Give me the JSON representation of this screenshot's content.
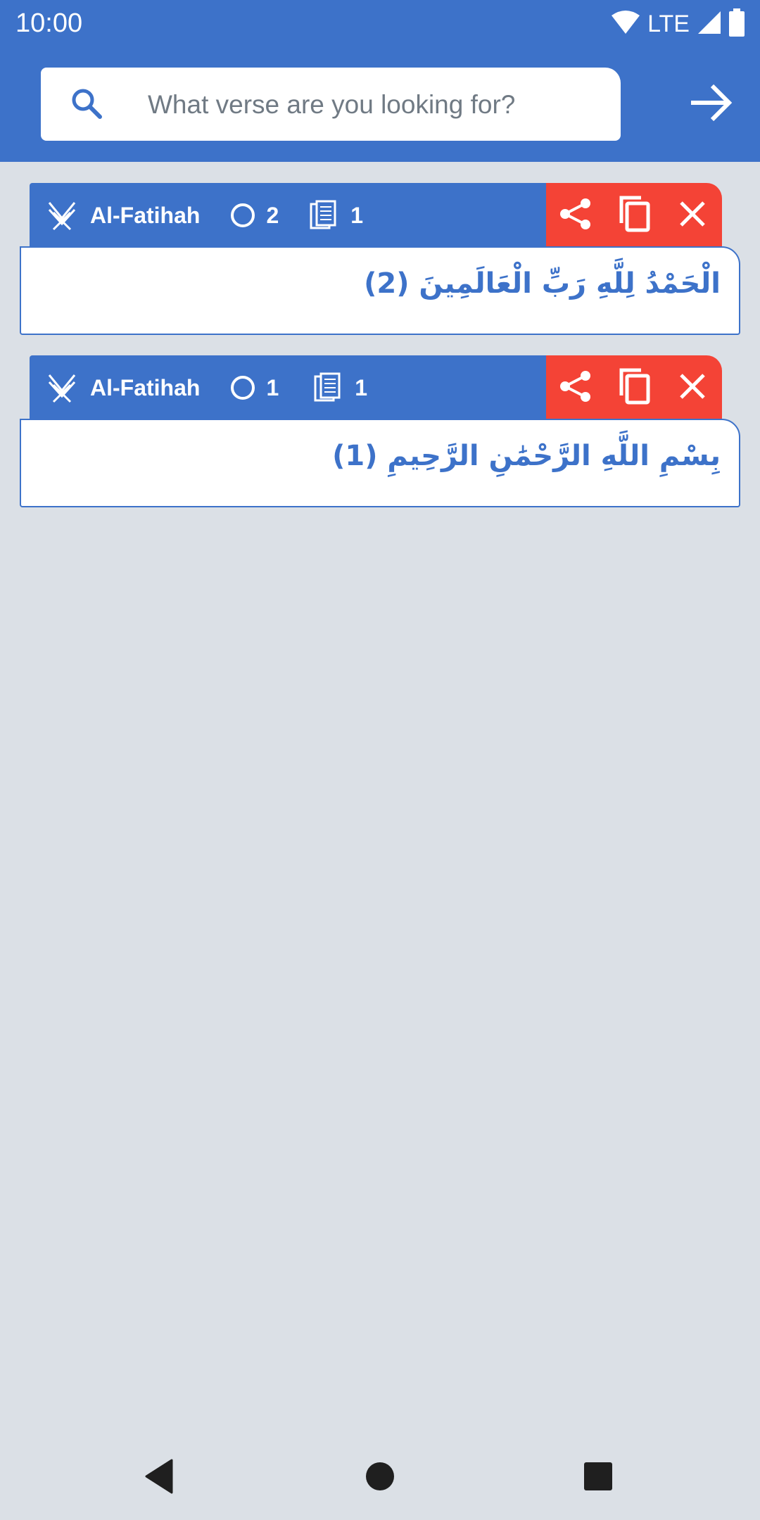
{
  "status_bar": {
    "time": "10:00",
    "network": "LTE",
    "icons": [
      "wifi-icon",
      "signal-icon",
      "battery-icon"
    ]
  },
  "search": {
    "placeholder": "What verse are you looking for?",
    "value": "",
    "search_icon": "search-icon",
    "submit_icon": "arrow-right-icon"
  },
  "colors": {
    "primary": "#3d72c9",
    "danger": "#f44336",
    "background": "#dbe0e6",
    "surface": "#ffffff"
  },
  "results": [
    {
      "surah": "Al-Fatihah",
      "ayah_number": "2",
      "page": "1",
      "verse_text": "الْحَمْدُ لِلَّهِ رَبِّ الْعَالَمِينَ (2)",
      "actions": [
        "share-icon",
        "copy-icon",
        "close-icon"
      ]
    },
    {
      "surah": "Al-Fatihah",
      "ayah_number": "1",
      "page": "1",
      "verse_text": "بِسْمِ اللَّهِ الرَّحْمَٰنِ الرَّحِيمِ (1)",
      "actions": [
        "share-icon",
        "copy-icon",
        "close-icon"
      ]
    }
  ],
  "nav_bar": [
    "back-icon",
    "home-icon",
    "recents-icon"
  ]
}
